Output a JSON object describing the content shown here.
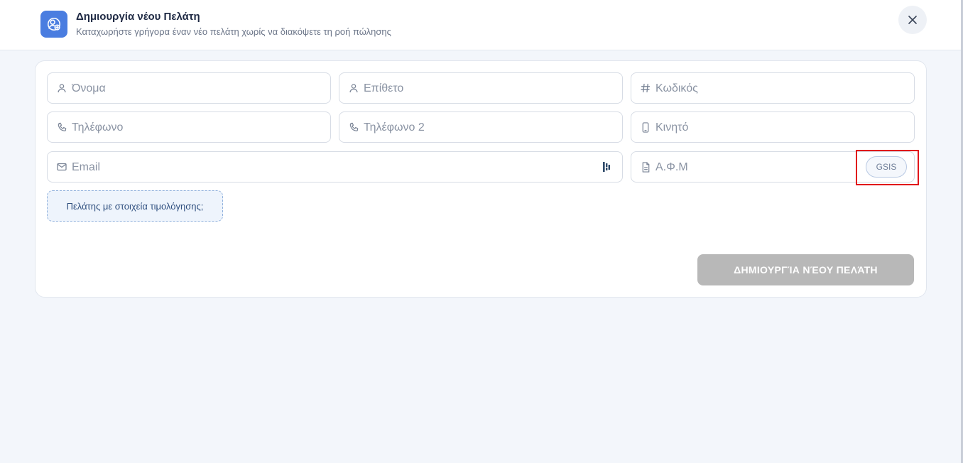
{
  "header": {
    "title": "Δημιουργία νέου Πελάτη",
    "subtitle": "Καταχωρήστε γρήγορα έναν νέο πελάτη χωρίς να διακόψετε τη ροή πώλησης",
    "accent_color": "#4a7de0",
    "icon": "user-add-icon",
    "close_icon": "close-icon"
  },
  "form": {
    "first_name": {
      "placeholder": "Όνομα",
      "value": "",
      "icon": "user-icon"
    },
    "last_name": {
      "placeholder": "Επίθετο",
      "value": "",
      "icon": "user-icon"
    },
    "code": {
      "placeholder": "Κωδικός",
      "value": "",
      "icon": "hash-icon"
    },
    "phone": {
      "placeholder": "Τηλέφωνο",
      "value": "",
      "icon": "phone-icon"
    },
    "phone2": {
      "placeholder": "Τηλέφωνο 2",
      "value": "",
      "icon": "phone-icon"
    },
    "mobile": {
      "placeholder": "Κινητό",
      "value": "",
      "icon": "mobile-icon"
    },
    "email": {
      "placeholder": "Email",
      "value": "",
      "icon": "mail-icon",
      "extra_icon": "password-manager-icon"
    },
    "vat": {
      "placeholder": "Α.Φ.Μ",
      "value": "",
      "icon": "document-icon"
    },
    "gsis_label": "GSIS",
    "invoice_toggle_label": "Πελάτης με στοιχεία τιμολόγησης;",
    "submit_label": "ΔΗΜΙΟΥΡΓΊΑ ΝΈΟΥ ΠΕΛΆΤΗ",
    "submit_disabled_color": "#b8b8b8"
  }
}
